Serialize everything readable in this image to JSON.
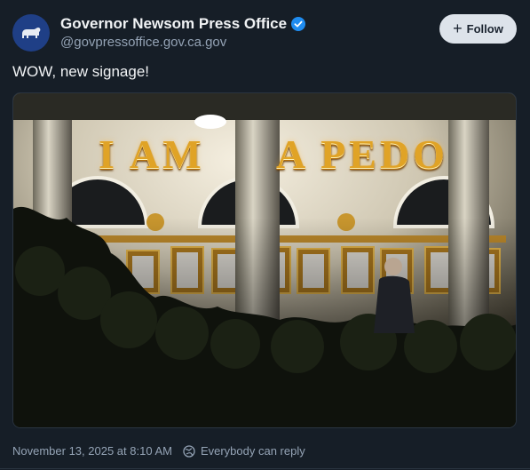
{
  "post": {
    "author_name": "Governor Newsom Press Office",
    "author_handle": "@govpressoffice.gov.ca.gov",
    "follow_label": "Follow",
    "text": "WOW, new signage!",
    "timestamp": "November 13, 2025 at 8:10 AM",
    "reply_setting": "Everybody can reply"
  },
  "image": {
    "sign_left": "I AM",
    "sign_right": "A PEDO"
  },
  "icons": {
    "avatar": "bear-icon",
    "verified": "verified-badge-icon",
    "follow": "plus-icon",
    "reply": "globe-icon"
  },
  "colors": {
    "background": "#161e27",
    "verified": "#1f8cf0",
    "follow_button": "#dde3ea",
    "muted_text": "#94a3b5"
  }
}
